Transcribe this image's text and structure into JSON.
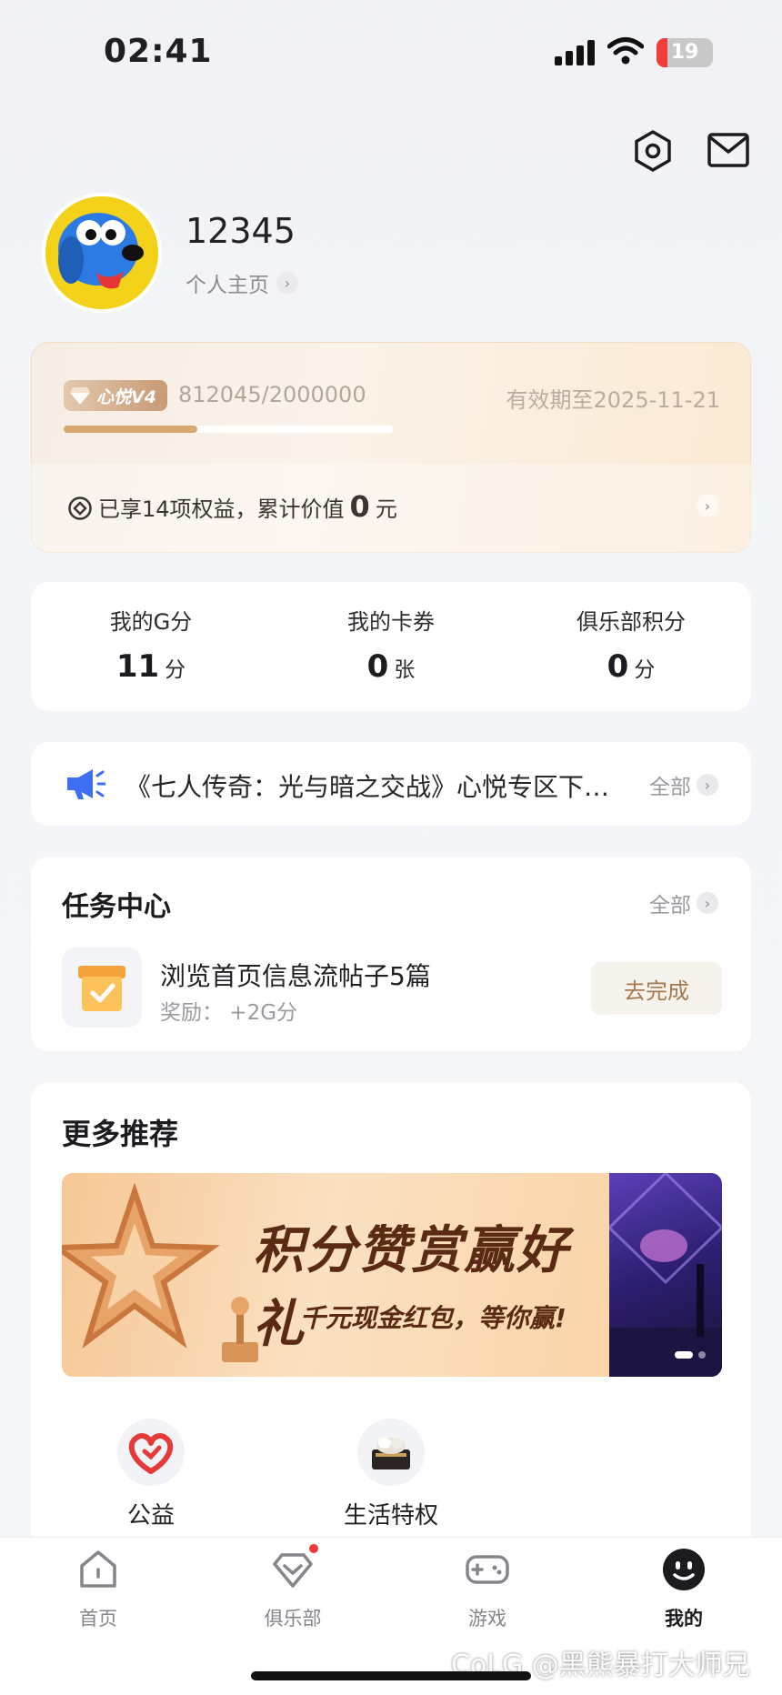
{
  "status_bar": {
    "time": "02:41",
    "battery": "19"
  },
  "profile": {
    "username": "12345",
    "homepage_link": "个人主页"
  },
  "vip": {
    "level_badge": "心悦V4",
    "progress_text": "812045/2000000",
    "progress_fraction": 0.406,
    "expire_text": "有效期至2025-11-21",
    "benefit_prefix": "已享14项权益，累计价值",
    "benefit_value": "0",
    "benefit_unit": "元"
  },
  "stats": [
    {
      "label": "我的G分",
      "value": "11",
      "unit": "分"
    },
    {
      "label": "我的卡券",
      "value": "0",
      "unit": "张"
    },
    {
      "label": "俱乐部积分",
      "value": "0",
      "unit": "分"
    }
  ],
  "notice": {
    "text": "《七人传奇：光与暗之交战》心悦专区下…",
    "all_label": "全部"
  },
  "task_center": {
    "title": "任务中心",
    "all_label": "全部",
    "task": {
      "name": "浏览首页信息流帖子5篇",
      "reward": "奖励： +2G分",
      "button": "去完成"
    }
  },
  "more": {
    "title": "更多推荐",
    "banner": {
      "headline": "积分赞赏赢好礼",
      "subline": "千元现金红包，等你赢!"
    },
    "services": [
      {
        "label": "公益",
        "icon": "heart-icon"
      },
      {
        "label": "生活特权",
        "icon": "gift-box-icon"
      }
    ]
  },
  "tabs": [
    {
      "label": "首页",
      "icon": "home-icon"
    },
    {
      "label": "俱乐部",
      "icon": "club-icon"
    },
    {
      "label": "游戏",
      "icon": "gamepad-icon"
    },
    {
      "label": "我的",
      "icon": "profile-icon"
    }
  ],
  "watermark": "CoLG @黑熊暴打大师兄",
  "colors": {
    "accent": "#d8a874",
    "red_dot": "#f03838",
    "task_button_text": "#a5794f"
  }
}
